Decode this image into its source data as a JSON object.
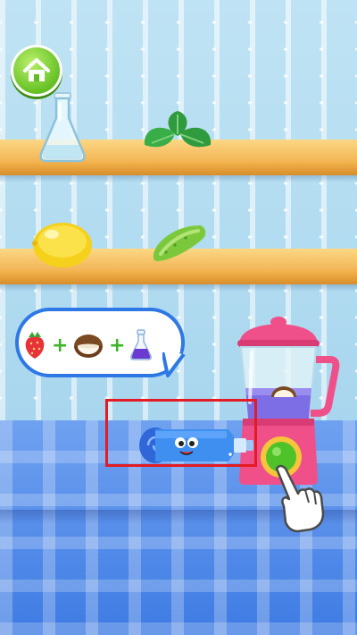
{
  "scene": "smoothie-maker",
  "home_button": {
    "icon": "home-icon",
    "color": "#6cc428"
  },
  "shelves": {
    "top": [
      {
        "item": "glass-flask-icon"
      },
      {
        "item": "mint-leaves-icon"
      }
    ],
    "middle": [
      {
        "item": "lemon-icon"
      },
      {
        "item": "cucumber-icon"
      }
    ]
  },
  "recipe_bubble": {
    "ingredients": [
      "strawberry-icon",
      "coconut-icon",
      "potion-flask-icon"
    ],
    "separator": "+"
  },
  "blender": {
    "body_color": "#f0508a",
    "button_color": "#4fc22a"
  },
  "highlight_color": "#e31b23",
  "colors": {
    "wall": "#b4dcf1",
    "shelf": "#f6c264",
    "cloth": "#4f88e8"
  }
}
